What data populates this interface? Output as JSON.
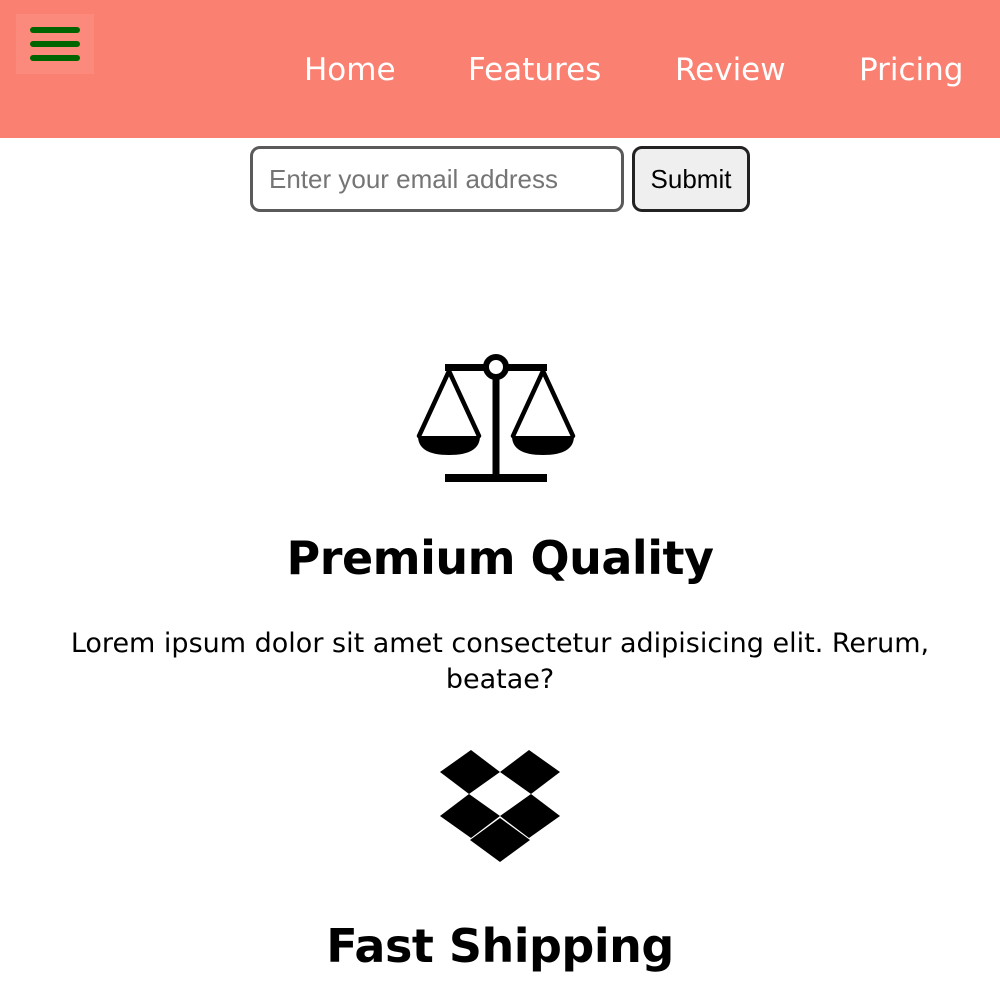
{
  "header": {
    "background_color": "#fa8072",
    "menu_icon": "hamburger-menu-icon",
    "menu_icon_color": "#006400",
    "nav": [
      {
        "label": "Home"
      },
      {
        "label": "Features"
      },
      {
        "label": "Review"
      },
      {
        "label": "Pricing"
      }
    ]
  },
  "signup": {
    "email_placeholder": "Enter your email address",
    "email_value": "",
    "submit_label": "Submit"
  },
  "features": [
    {
      "icon": "balance-scale-icon",
      "title": "Premium Quality",
      "text": "Lorem ipsum dolor sit amet consectetur adipisicing elit. Rerum, beatae?"
    },
    {
      "icon": "dropbox-icon",
      "title": "Fast Shipping"
    }
  ]
}
